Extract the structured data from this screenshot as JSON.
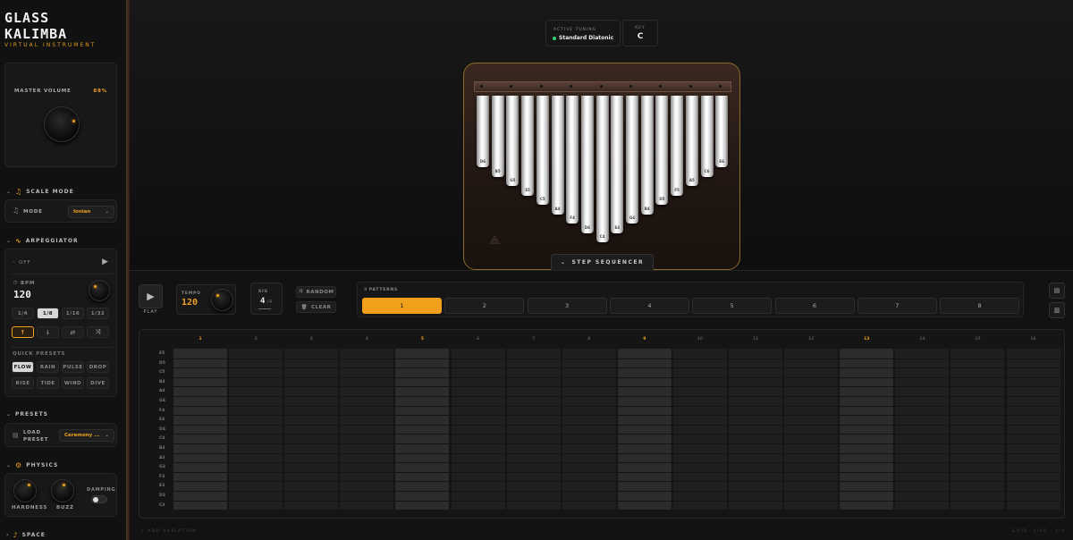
{
  "brand": {
    "title": "GLASS KALIMBA",
    "subtitle": "VIRTUAL INSTRUMENT"
  },
  "master": {
    "label": "MASTER VOLUME",
    "value": "88%",
    "level": 0.88
  },
  "scale": {
    "section": "SCALE MODE",
    "mode_label": "MODE",
    "mode_value": "Ionian"
  },
  "arp": {
    "section": "ARPEGGIATOR",
    "state": "OFF",
    "bpm_label": "BPM",
    "bpm": "120",
    "rates": [
      "1/4",
      "1/8",
      "1/16",
      "1/32"
    ],
    "active_rate": 1,
    "directions": [
      "up-arrow-icon",
      "down-arrow-icon",
      "bounce-icon",
      "shuffle-icon"
    ],
    "presets_label": "QUICK PRESETS",
    "presets": [
      "FLOW",
      "RAIN",
      "PULSE",
      "DROP",
      "RISE",
      "TIDE",
      "WIND",
      "DIVE"
    ]
  },
  "presets": {
    "section": "PRESETS",
    "load_label": "LOAD PRESET",
    "value": "Ceremony ..."
  },
  "physics": {
    "section": "PHYSICS",
    "hardness": "HARDNESS",
    "buzz": "BUZZ",
    "damping": "DAMPING"
  },
  "space": {
    "section": "SPACE"
  },
  "tuning": {
    "label": "ACTIVE TUNING",
    "value": "Standard Diatonic",
    "key_label": "KEY",
    "key": "C"
  },
  "kalimba": {
    "tines": [
      "D6",
      "B5",
      "G5",
      "E5",
      "C5",
      "A4",
      "F4",
      "D4",
      "C4",
      "E4",
      "G4",
      "B4",
      "D5",
      "F5",
      "A5",
      "C6",
      "E6"
    ],
    "accent": "#f0a020"
  },
  "sequencer": {
    "tab": "STEP SEQUENCER",
    "play": "PLAY",
    "tempo_label": "TEMPO",
    "tempo": "120",
    "sig_label": "SIG",
    "sig_num": "4",
    "sig_den": "/4",
    "random": "RANDOM",
    "clear": "CLEAR",
    "patterns_label": "PATTERNS",
    "patterns": [
      "1",
      "2",
      "3",
      "4",
      "5",
      "6",
      "7",
      "8"
    ],
    "active_pattern": 0,
    "steps": [
      "1",
      "2",
      "3",
      "4",
      "5",
      "6",
      "7",
      "8",
      "9",
      "10",
      "11",
      "12",
      "13",
      "14",
      "15",
      "16"
    ],
    "rows": [
      "E5",
      "D5",
      "C5",
      "B4",
      "A4",
      "G4",
      "F4",
      "E4",
      "D4",
      "C4",
      "B3",
      "A3",
      "G3",
      "F3",
      "E3",
      "D3",
      "C3"
    ],
    "add_variation": "+ ADD VARIATION",
    "grid_info": "GRID: 1/16 · 4/4"
  }
}
